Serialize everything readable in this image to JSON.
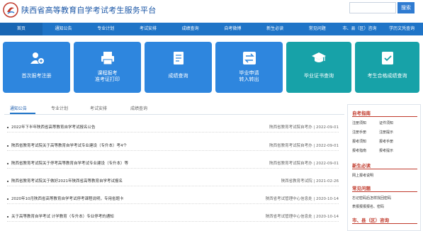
{
  "header": {
    "site_title": "陕西省高等教育自学考试考生服务平台",
    "search_placeholder": "",
    "search_label": "搜索"
  },
  "nav": {
    "items": [
      "首页",
      "通知公告",
      "专业计划",
      "考试安排",
      "成绩查询",
      "自考微博",
      "新生必读",
      "常见问题",
      "市、县（区）咨询",
      "学历文凭查询"
    ]
  },
  "tiles": [
    {
      "label": "首次报考注册",
      "icon": "user-add-icon",
      "color": "#2e86de"
    },
    {
      "label": "课程报考\n准考证打印",
      "icon": "printer-icon",
      "color": "#2e86de"
    },
    {
      "label": "成绩查询",
      "icon": "document-icon",
      "color": "#2e86de"
    },
    {
      "label": "毕业申请\n转入转出",
      "icon": "transfer-icon",
      "color": "#2e86de"
    },
    {
      "label": "毕业证书查询",
      "icon": "graduation-cap-icon",
      "color": "#17a2a8"
    },
    {
      "label": "考生合格成绩查询",
      "icon": "check-list-icon",
      "color": "#17a2a8"
    }
  ],
  "tabs": [
    "通知公告",
    "专业计划",
    "考试安排",
    "成绩查询"
  ],
  "notices": [
    {
      "title": "2022年下半年陕西省高等教育自学考试报名公告",
      "source": "陕西省教育考试院自考办",
      "date": "2022-09-01"
    },
    {
      "title": "陕西省教育考试院关于高等教育自学考试专业建设（专升本）考4个",
      "source": "陕西省教育考试院自考办",
      "date": "2022-09-01"
    },
    {
      "title": "陕西省教育考试院关于停考高等教育自学考试专业建设（专升本）等",
      "source": "陕西省教育考试院自考办",
      "date": "2022-09-01"
    },
    {
      "title": "陕西省教育考试院关于做好2021年陕西省高等教育自学考试报名",
      "source": "陕西省教育考试院",
      "date": "2021-02-26"
    },
    {
      "title": "2020年10月陕西省高等教育自学考试停考课程说明，专用省题卡",
      "source": "陕西省考试管理中心信息处",
      "date": "2020-10-14"
    },
    {
      "title": "关于高等教育自学考试 计学教育（专升本）专业停考的通知",
      "source": "陕西省考试管理中心信息处",
      "date": "2020-10-14"
    }
  ],
  "sidebar": {
    "guide_title": "自考指南",
    "guide_links": [
      "注册须知",
      "证件须知",
      "注册手册",
      "注册提示",
      "报考须知",
      "报考手册",
      "报考指南",
      "报考提示"
    ],
    "new_title": "新生必读",
    "new_items": [
      "网上报考说明"
    ],
    "faq_title": "常见问题",
    "faq_items": [
      "忘记密码后怎样找回密码",
      "表报报报报名、密码"
    ],
    "consult_title": "市、县（区）咨询"
  }
}
